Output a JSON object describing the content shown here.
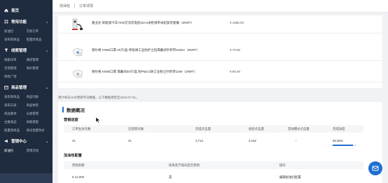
{
  "sidebar": {
    "home": "首页",
    "sections": [
      {
        "title": "常用功能",
        "items": [
          "加油包",
          "交易订单",
          "发布新商品",
          "批量改商品"
        ]
      },
      {
        "title": "线索管理",
        "items": [
          "线索详单",
          "通话管理",
          "咨询管理",
          "询价管理",
          "商机广场"
        ]
      },
      {
        "title": "商品管理",
        "items": [
          "发布新商品",
          "商品列表",
          "发布记录",
          "商品体检",
          "商品素材",
          "分类管理",
          "主推商品",
          "关联搭配",
          "批量改商品",
          "商详批量改价"
        ]
      },
      {
        "title": "营销中心",
        "items": [
          "加油包",
          "营销活动"
        ]
      }
    ]
  },
  "header": {
    "breadcrumb_1": "加油包",
    "breadcrumb_2": "订单详情"
  },
  "products": [
    {
      "name": "嘉业达 新能源汽车7KW交流充电桩32A4米枪线带米起安装套餐（ZNRT）",
      "price": "¥ 1598.00"
    },
    {
      "name": "德尔格 KN95口罩 20只/盒 呼吸阀工业防护尘粒耳戴式针织带1165V（ZNRT）",
      "price": "¥ 79.00"
    },
    {
      "name": "德尔格 KN95口罩 耳戴式50只/盒 防PM2.5防工业粉尘针织带1190（ZNRT）",
      "price": "¥ 90.00"
    }
  ],
  "notice": "预计每日10点更新昨日数据，以下数据更新至2023-07-01。",
  "overview": {
    "title": "数据概况",
    "progress_section": {
      "title": "营销进度",
      "headers": [
        "订单生效天数",
        "已营销天数",
        "完成点击量",
        "保底点击量",
        "其他曝光点击量",
        "完成进度"
      ],
      "row": [
        "41",
        "41",
        "2,712",
        "3,162",
        "--",
        "85.58%"
      ],
      "progress": 0.8558
    },
    "config_section": {
      "title": "加油包配置",
      "headers": [
        "营销金额",
        "商来及节假日是否营销",
        "操作"
      ],
      "row": [
        "¥ 12,000",
        "是",
        "编辑加油包配置"
      ]
    }
  }
}
